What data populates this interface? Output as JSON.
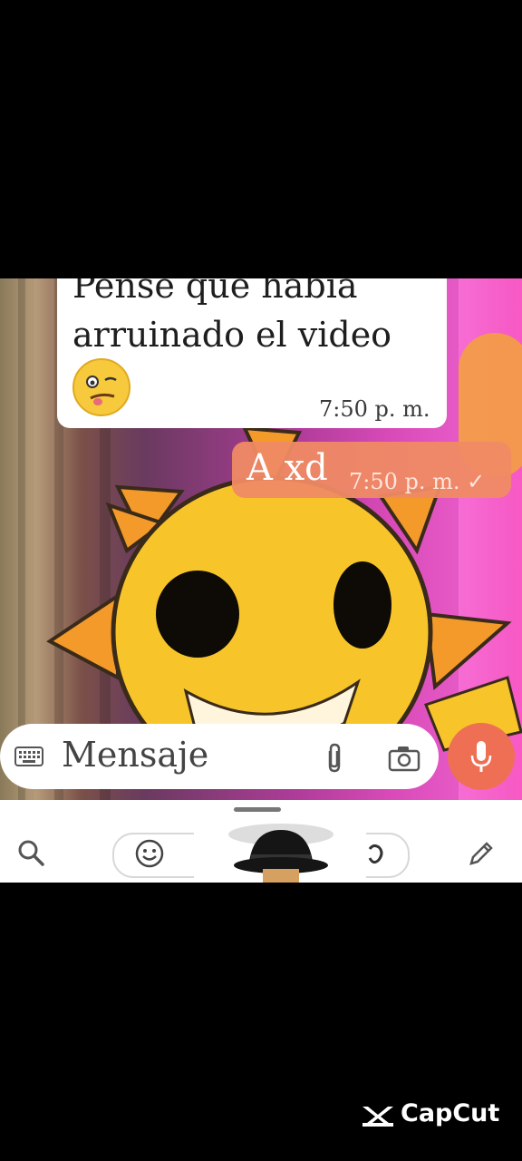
{
  "chat": {
    "incoming_line1": "Pense que habia",
    "incoming_line2": "arruinado el video",
    "incoming_emoji": "woozy-face-emoji",
    "incoming_time": "7:50 p. m.",
    "outgoing_text": "A xd",
    "outgoing_time": "7:50 p. m. ✓"
  },
  "composer": {
    "placeholder": "Mensaje",
    "icons": [
      "keyboard-icon",
      "paperclip-icon",
      "camera-icon",
      "microphone-icon"
    ],
    "mic_color": "#ef6f55"
  },
  "keyboard_bar": {
    "icons": [
      "search-icon",
      "smile-icon",
      "gif-icon",
      "pencil-icon"
    ]
  },
  "watermark": {
    "brand": "CapCut"
  },
  "colors": {
    "incoming_bubble": "#ffffff",
    "outgoing_bubble": "#ef8a64",
    "sun_yellow": "#f7c52a",
    "sun_orange": "#f39a2a"
  }
}
